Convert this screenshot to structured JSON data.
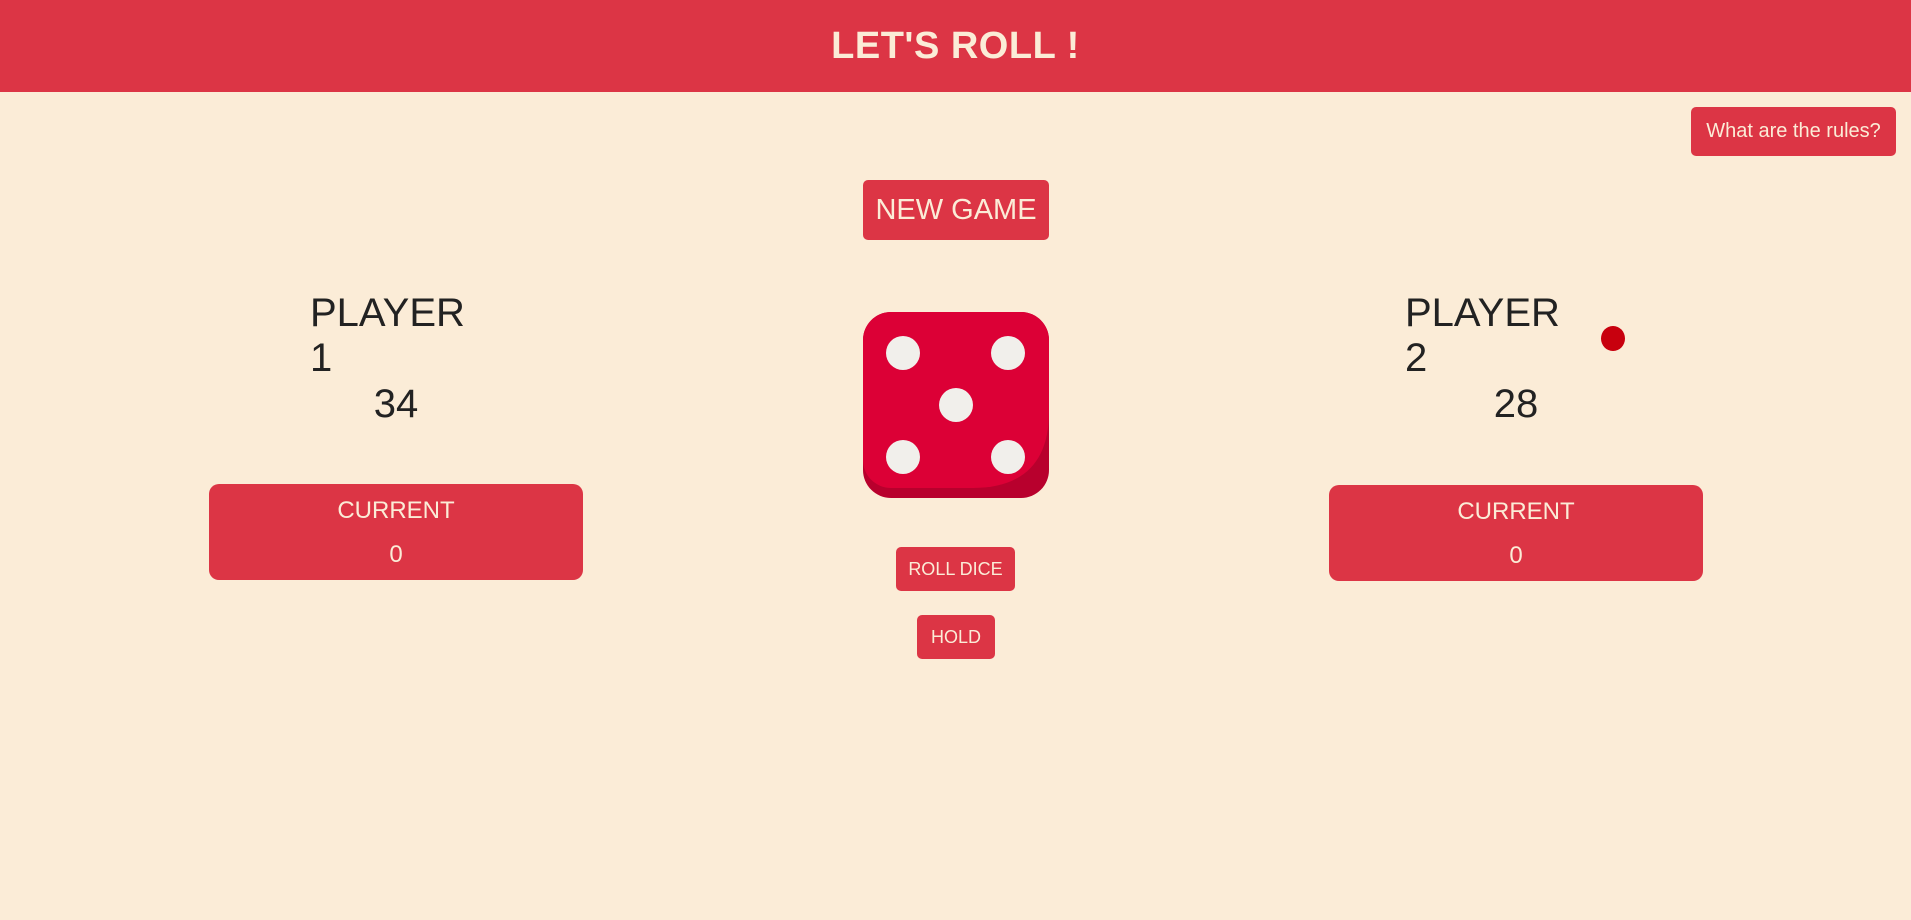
{
  "header": {
    "title": "LET'S ROLL !"
  },
  "controls": {
    "rules_label": "What are the rules?",
    "new_game_label": "NEW GAME",
    "roll_label": "ROLL DICE",
    "hold_label": "HOLD"
  },
  "players": [
    {
      "name": "PLAYER 1",
      "score": "34",
      "current_label": "CURRENT",
      "current_value": "0",
      "active": false
    },
    {
      "name": "PLAYER 2",
      "score": "28",
      "current_label": "CURRENT",
      "current_value": "0",
      "active": true
    }
  ],
  "dice": {
    "value": 5,
    "icon": "dice-five-icon"
  },
  "colors": {
    "background": "#fbecd7",
    "accent": "#dc3545",
    "dice": "#dc0036",
    "active_indicator": "#c8000e"
  }
}
